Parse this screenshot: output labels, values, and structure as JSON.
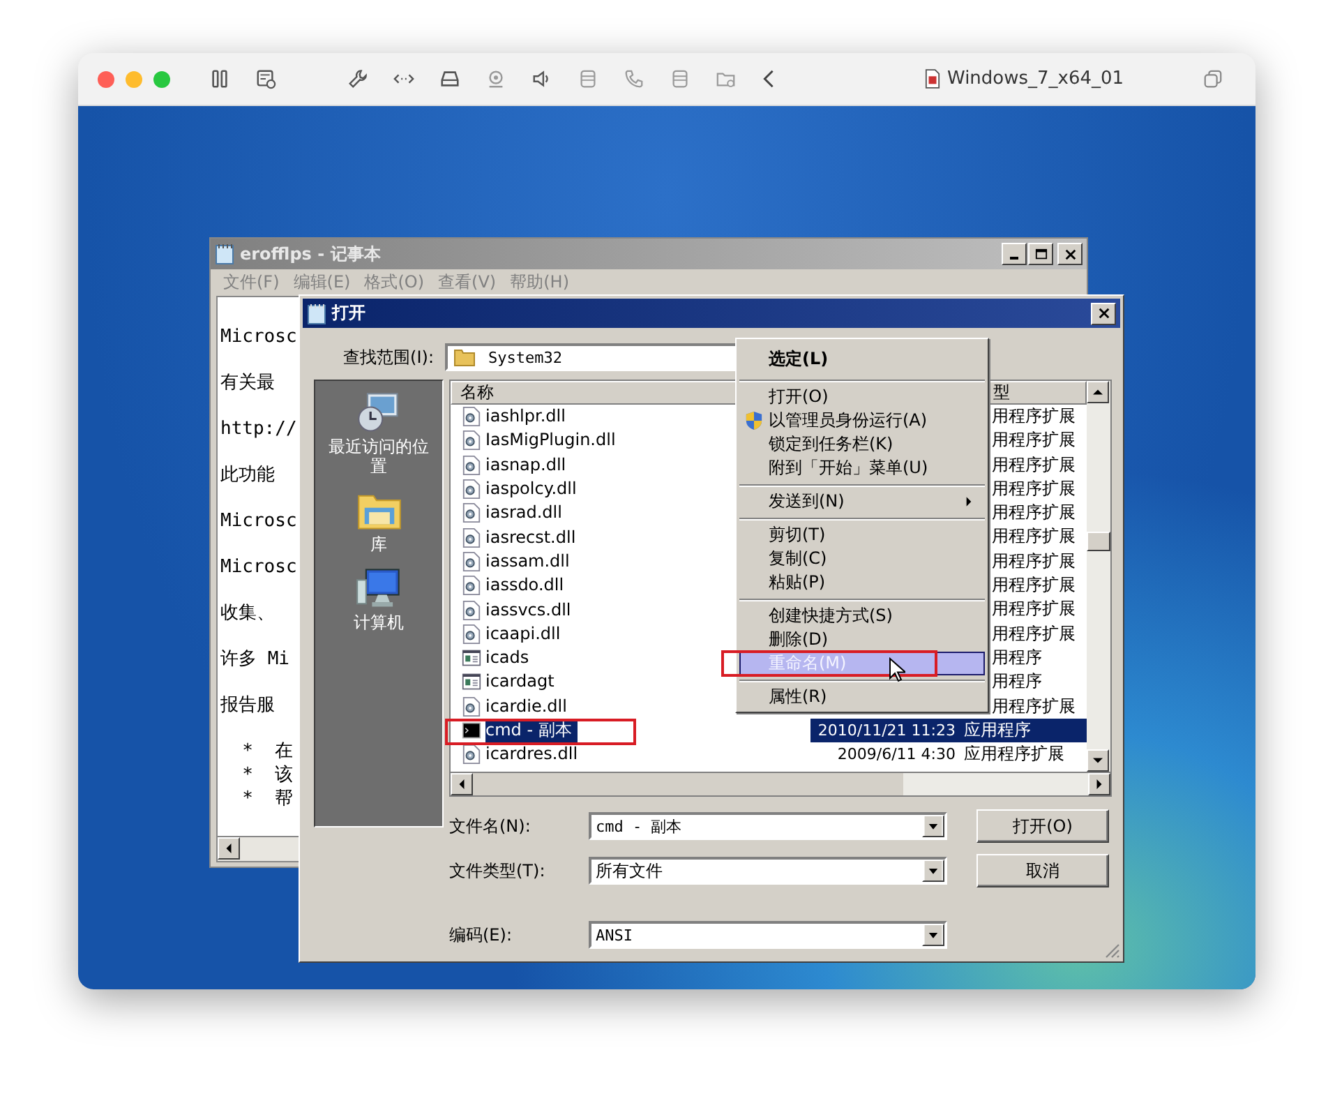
{
  "host_window": {
    "title": "Windows_7_x64_01"
  },
  "notepad": {
    "title": "erofflps - 记事本",
    "menu": [
      "文件(F)",
      "编辑(E)",
      "格式(O)",
      "查看(V)",
      "帮助(H)"
    ],
    "paragraphs": [
      [
        "Microsc"
      ],
      [
        "有关最"
      ],
      [
        "http://"
      ],
      [
        "此功能"
      ],
      [
        "Microsc"
      ],
      [
        "Microsc"
      ],
      [
        "收集、"
      ],
      [
        "许多 Mi"
      ],
      [
        "报告服"
      ],
      [
        "  *  在",
        "  *  该",
        "  *  帮"
      ]
    ]
  },
  "open_dialog": {
    "title": "打开",
    "look_in_label": "查找范围(I):",
    "look_in_value": "System32",
    "places": [
      {
        "kind": "recent",
        "label": "最近访问的位置"
      },
      {
        "kind": "library",
        "label": "库"
      },
      {
        "kind": "computer",
        "label": "计算机"
      }
    ],
    "columns": [
      "名称",
      "型"
    ],
    "files": [
      {
        "kind": "dll",
        "name": "iashlpr.dll",
        "type": "用程序扩展",
        "selected": false
      },
      {
        "kind": "dll",
        "name": "IasMigPlugin.dll",
        "type": "用程序扩展",
        "selected": false
      },
      {
        "kind": "dll",
        "name": "iasnap.dll",
        "type": "用程序扩展",
        "selected": false
      },
      {
        "kind": "dll",
        "name": "iaspolcy.dll",
        "type": "用程序扩展",
        "selected": false
      },
      {
        "kind": "dll",
        "name": "iasrad.dll",
        "type": "用程序扩展",
        "selected": false
      },
      {
        "kind": "dll",
        "name": "iasrecst.dll",
        "type": "用程序扩展",
        "selected": false
      },
      {
        "kind": "dll",
        "name": "iassam.dll",
        "type": "用程序扩展",
        "selected": false
      },
      {
        "kind": "dll",
        "name": "iassdo.dll",
        "type": "用程序扩展",
        "selected": false
      },
      {
        "kind": "dll",
        "name": "iassvcs.dll",
        "type": "用程序扩展",
        "selected": false
      },
      {
        "kind": "dll",
        "name": "icaapi.dll",
        "type": "用程序扩展",
        "selected": false
      },
      {
        "kind": "app",
        "name": "icads",
        "type": "用程序",
        "selected": false
      },
      {
        "kind": "app",
        "name": "icardagt",
        "type": "用程序",
        "selected": false
      },
      {
        "kind": "dll",
        "name": "icardie.dll",
        "type": "用程序扩展",
        "selected": false
      },
      {
        "kind": "cmd",
        "name": "cmd - 副本",
        "date": "2010/11/21 11:23",
        "type": "应用程序",
        "selected": true
      },
      {
        "kind": "dll",
        "name": "icardres.dll",
        "date": "2009/6/11 4:30",
        "type": "应用程序扩展",
        "selected": false
      }
    ],
    "filename_label": "文件名(N):",
    "filename_value": "cmd - 副本",
    "filetype_label": "文件类型(T):",
    "filetype_value": "所有文件",
    "encoding_label": "编码(E):",
    "encoding_value": "ANSI",
    "buttons": [
      "打开(O)",
      "取消"
    ]
  },
  "context_menu": {
    "items": [
      {
        "kind": "item",
        "label": "选定(L)",
        "default": true,
        "submenu": false,
        "selected": false
      },
      {
        "kind": "separator"
      },
      {
        "kind": "item",
        "label": "打开(O)",
        "default": false,
        "submenu": false,
        "selected": false
      },
      {
        "kind": "shield_item",
        "label": "以管理员身份运行(A)",
        "default": false,
        "submenu": false,
        "selected": false
      },
      {
        "kind": "item",
        "label": "锁定到任务栏(K)",
        "default": false,
        "submenu": false,
        "selected": false
      },
      {
        "kind": "item",
        "label": "附到「开始」菜单(U)",
        "default": false,
        "submenu": false,
        "selected": false
      },
      {
        "kind": "separator"
      },
      {
        "kind": "item",
        "label": "发送到(N)",
        "default": false,
        "submenu": true,
        "selected": false
      },
      {
        "kind": "separator"
      },
      {
        "kind": "item",
        "label": "剪切(T)",
        "default": false,
        "submenu": false,
        "selected": false
      },
      {
        "kind": "item",
        "label": "复制(C)",
        "default": false,
        "submenu": false,
        "selected": false
      },
      {
        "kind": "item",
        "label": "粘贴(P)",
        "default": false,
        "submenu": false,
        "selected": false
      },
      {
        "kind": "separator"
      },
      {
        "kind": "item",
        "label": "创建快捷方式(S)",
        "default": false,
        "submenu": false,
        "selected": false
      },
      {
        "kind": "item",
        "label": "删除(D)",
        "default": false,
        "submenu": false,
        "selected": false
      },
      {
        "kind": "item",
        "label": "重命名(M)",
        "default": false,
        "submenu": false,
        "selected": true
      },
      {
        "kind": "separator"
      },
      {
        "kind": "item",
        "label": "属性(R)",
        "default": false,
        "submenu": false,
        "selected": false
      }
    ]
  }
}
